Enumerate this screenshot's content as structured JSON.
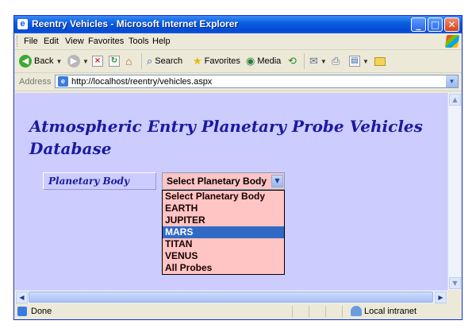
{
  "window": {
    "title": "Reentry Vehicles - Microsoft Internet Explorer",
    "buttons": {
      "minimize": "_",
      "maximize": "□",
      "close": "✕"
    }
  },
  "menu": [
    "File",
    "Edit",
    "View",
    "Favorites",
    "Tools",
    "Help"
  ],
  "toolbar": {
    "back": "Back",
    "search": "Search",
    "favorites": "Favorites",
    "media": "Media"
  },
  "address": {
    "label": "Address",
    "url": "http://localhost/reentry/vehicles.aspx"
  },
  "page": {
    "heading": "Atmospheric Entry Planetary Probe Vehicles Database",
    "field_label": "Planetary Body",
    "select_value": "Select Planetary Body",
    "options": [
      "Select Planetary Body",
      "EARTH",
      "JUPITER",
      "MARS",
      "TITAN",
      "VENUS",
      "All Probes"
    ],
    "highlighted_option": "MARS"
  },
  "status": {
    "text": "Done",
    "zone": "Local intranet"
  },
  "colors": {
    "page_background": "#ccccff",
    "heading": "#1a1aa0",
    "select_background": "#ffc4c4",
    "highlight": "#316ac5"
  }
}
